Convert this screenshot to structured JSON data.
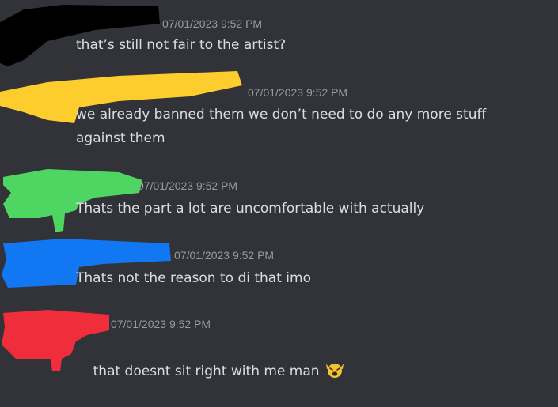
{
  "messages": [
    {
      "timestamp": "07/01/2023 9:52 PM",
      "text": "that’s still not fair to the artist?",
      "name_redaction_color": "#000000"
    },
    {
      "timestamp": "07/01/2023 9:52 PM",
      "text": "we already banned them we don’t need to do any more stuff against them",
      "name_redaction_color": "#fdcc2d"
    },
    {
      "timestamp": "07/01/2023 9:52 PM",
      "text": "Thats the part a lot are uncomfortable with actually",
      "name_redaction_color": "#4fd561"
    },
    {
      "timestamp": "07/01/2023 9:52 PM",
      "text": "Thats not the reason to di that imo",
      "name_redaction_color": "#1177f3"
    },
    {
      "timestamp": "07/01/2023 9:52 PM",
      "text": "that doesnt sit right with me man",
      "name_redaction_color": "#f02d3a",
      "emoji": "weary-face-emoji"
    }
  ],
  "colors": {
    "background": "#313338",
    "message_text": "#dbdee1",
    "timestamp": "#949ba4"
  }
}
